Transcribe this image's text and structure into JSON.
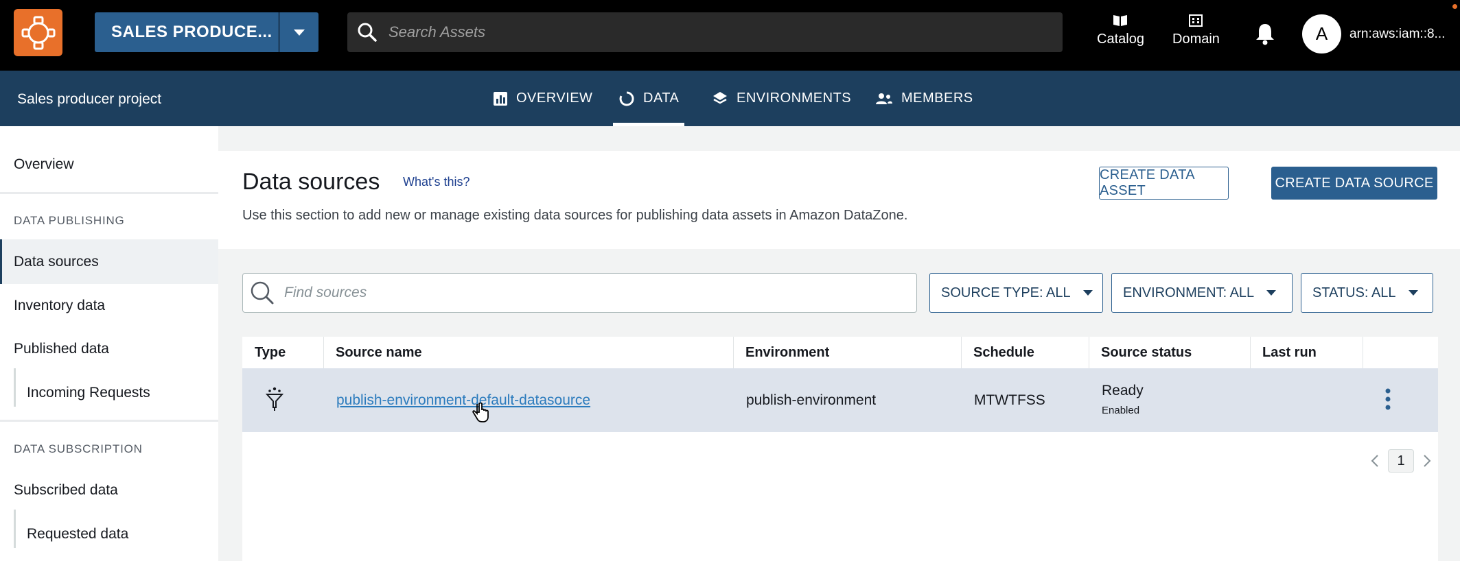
{
  "topbar": {
    "project_selector": "SALES PRODUCE...",
    "search_placeholder": "Search Assets",
    "catalog": "Catalog",
    "domain": "Domain",
    "avatar_letter": "A",
    "account": "arn:aws:iam::8..."
  },
  "project_bar": {
    "project_name": "Sales producer project",
    "tabs": [
      {
        "label": "OVERVIEW",
        "icon": "bar-chart-icon"
      },
      {
        "label": "DATA",
        "icon": "refresh-circle-icon",
        "active": true
      },
      {
        "label": "ENVIRONMENTS",
        "icon": "layers-icon"
      },
      {
        "label": "MEMBERS",
        "icon": "people-icon"
      }
    ]
  },
  "sidebar": {
    "overview": "Overview",
    "publishing_header": "DATA PUBLISHING",
    "data_sources": "Data sources",
    "inventory": "Inventory data",
    "published": "Published data",
    "incoming": "Incoming Requests",
    "subscription_header": "DATA SUBSCRIPTION",
    "subscribed": "Subscribed data",
    "requested": "Requested data"
  },
  "main": {
    "title": "Data sources",
    "whats_this": "What's this?",
    "description": "Use this section to add new or manage existing data sources for publishing data assets in Amazon DataZone.",
    "create_asset": "CREATE DATA ASSET",
    "create_source": "CREATE DATA SOURCE",
    "find_placeholder": "Find sources",
    "filters": {
      "source_type": "SOURCE TYPE: ALL",
      "environment": "ENVIRONMENT: ALL",
      "status": "STATUS: ALL"
    },
    "columns": [
      "Type",
      "Source name",
      "Environment",
      "Schedule",
      "Source status",
      "Last run"
    ],
    "rows": [
      {
        "type_icon": "glue-funnel-icon",
        "name": "publish-environment-default-datasource",
        "environment": "publish-environment",
        "schedule": "MTWTFSS",
        "status": "Ready",
        "status_sub": "Enabled",
        "last_run": ""
      }
    ],
    "page": "1"
  }
}
